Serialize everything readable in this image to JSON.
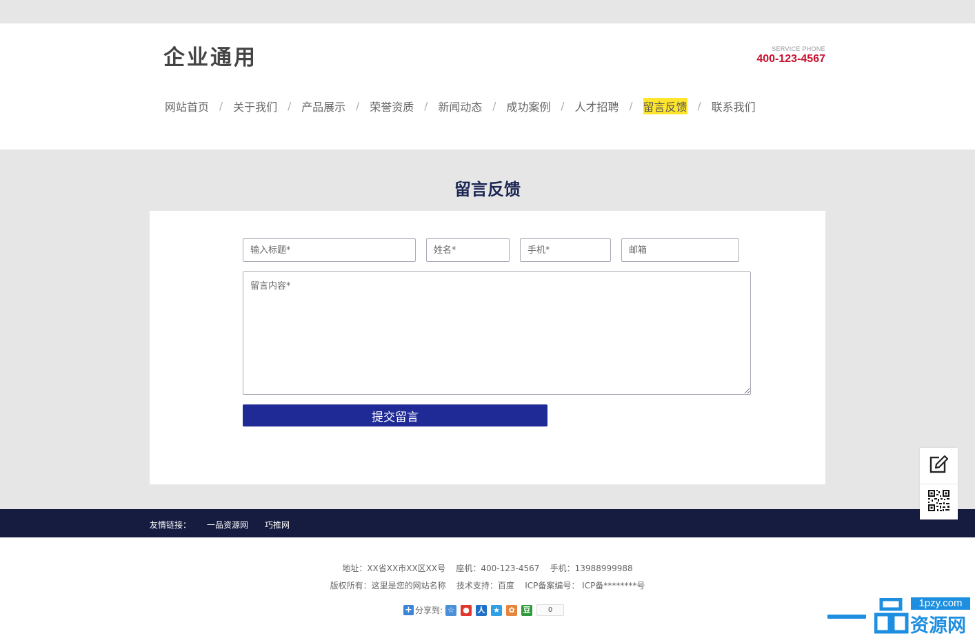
{
  "header": {
    "logo_text": "企业通用",
    "service_label": "SERVICE PHONE",
    "service_phone": "400-123-4567"
  },
  "nav": {
    "items": [
      {
        "label": "网站首页"
      },
      {
        "label": "关于我们"
      },
      {
        "label": "产品展示"
      },
      {
        "label": "荣誉资质"
      },
      {
        "label": "新闻动态"
      },
      {
        "label": "成功案例"
      },
      {
        "label": "人才招聘"
      },
      {
        "label": "留言反馈",
        "active": true
      },
      {
        "label": "联系我们"
      }
    ],
    "separator": "/",
    "active_color": "#ffe52b"
  },
  "page": {
    "title": "留言反馈"
  },
  "form": {
    "title_placeholder": "输入标题*",
    "name_placeholder": "姓名*",
    "phone_placeholder": "手机*",
    "email_placeholder": "邮箱",
    "content_placeholder": "留言内容*",
    "submit_label": "提交留言",
    "submit_color": "#1f2a96"
  },
  "friend_links": {
    "label": "友情链接：",
    "links": [
      "一品资源网",
      "巧推网"
    ]
  },
  "footer": {
    "line1": "地址：XX省XX市XX区XX号    座机：400-123-4567    手机：13988999988",
    "line2": "版权所有：这里是您的网站名称    技术支持：百度    ICP备案编号： ICP备********号"
  },
  "share": {
    "label": "分享到:",
    "count": "0",
    "icons": [
      "qzone-icon",
      "weibo-icon",
      "renren-icon",
      "qq-icon",
      "tencent-weibo-icon",
      "douban-icon"
    ]
  },
  "float_bar": {
    "icons": [
      "edit-icon",
      "qrcode-icon"
    ]
  },
  "watermark": {
    "tag": "1pzy.com",
    "text": "资源网"
  },
  "colors": {
    "brand_blue": "#1e8fe0",
    "footer_bar": "#161c40",
    "title_navy": "#1b2653",
    "phone_red": "#c8102e"
  }
}
